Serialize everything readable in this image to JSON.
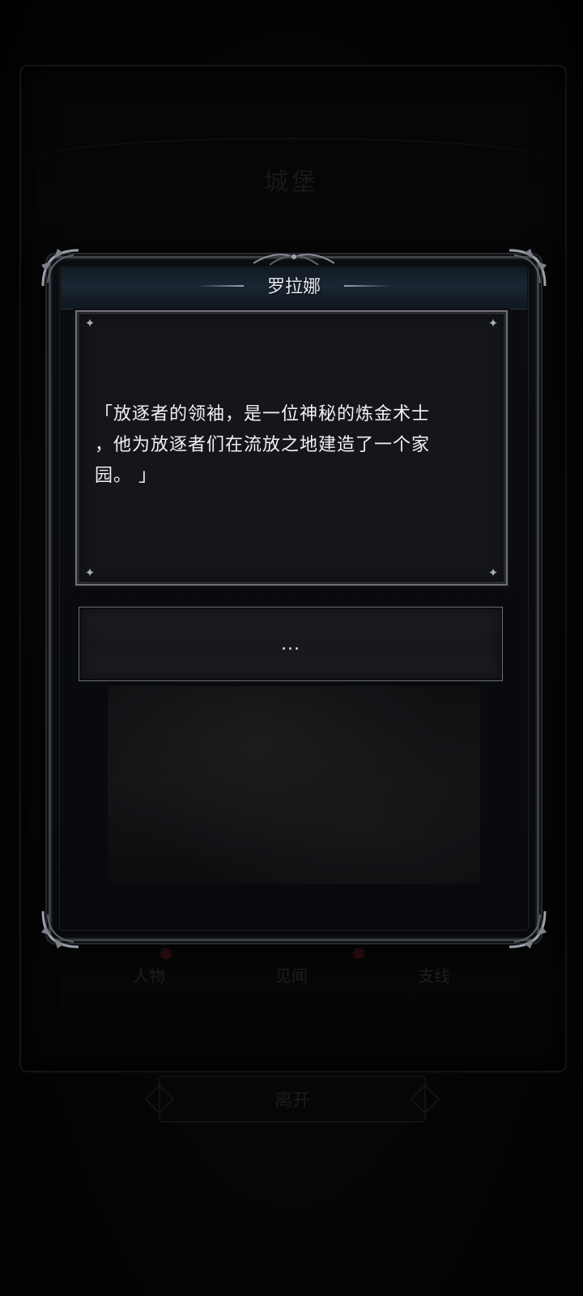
{
  "background": {
    "title": "城堡",
    "tabs": [
      {
        "label": "人物",
        "has_dot": true
      },
      {
        "label": "见闻",
        "has_dot": true
      },
      {
        "label": "支线",
        "has_dot": false
      }
    ],
    "leave_label": "离开"
  },
  "dialog": {
    "speaker_name": "罗拉娜",
    "message": "「放逐者的领袖，是一位神秘的炼金术士\n，他为放逐者们在流放之地建造了一个家\n园。 」",
    "reply_options": [
      {
        "label": "..."
      }
    ],
    "sparkle_icon": "✦"
  },
  "colors": {
    "header_band": "#1a2633",
    "dot_red": "#2a0b0e",
    "text": "#f1f2f5"
  }
}
